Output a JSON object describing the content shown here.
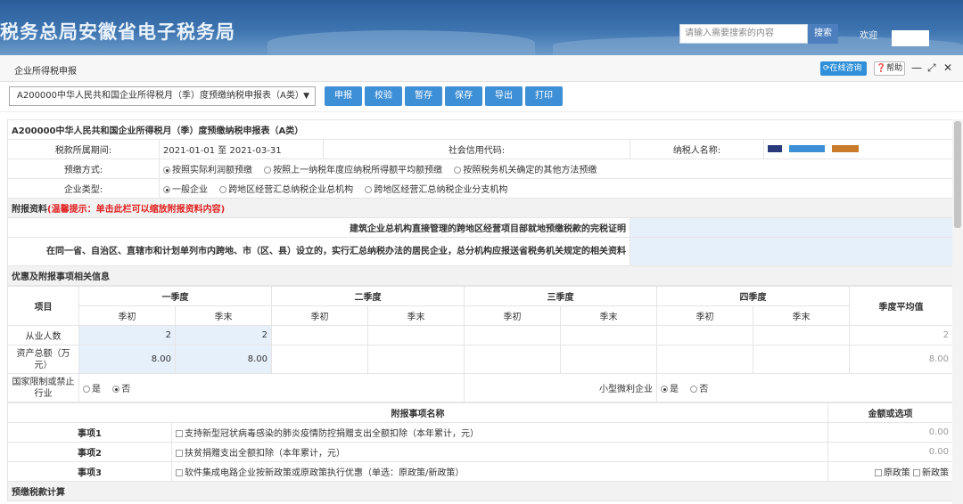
{
  "banner": {
    "title": "税务总局安徽省电子税务局",
    "search_placeholder": "请输入需要搜索的内容",
    "search_button": "搜索",
    "welcome": "欢迎"
  },
  "window": {
    "title": "企业所得税申报",
    "consult": "在线咨询",
    "help": "帮助",
    "minimize": "—",
    "maximize": "⤢",
    "close": "✕"
  },
  "toolbar": {
    "form_select": "A200000中华人民共和国企业所得税月（季）度预缴纳税申报表（A类）",
    "buttons": [
      "申报",
      "校验",
      "暂存",
      "保存",
      "导出",
      "打印"
    ]
  },
  "form": {
    "header": "A200000中华人民共和国企业所得税月（季）度预缴纳税申报表（A类）",
    "period_label": "税款所属期间:",
    "period_value": "2021-01-01 至 2021-03-31",
    "credit_code_label": "社会信用代码:",
    "taxpayer_label": "纳税人名称:",
    "prepay_label": "预缴方式:",
    "prepay_options": [
      "按照实际利润额预缴",
      "按照上一纳税年度应纳税所得额平均额预缴",
      "按照税务机关确定的其他方法预缴"
    ],
    "company_type_label": "企业类型:",
    "company_type_options": [
      "一般企业",
      "跨地区经营汇总纳税企业总机构",
      "跨地区经营汇总纳税企业分支机构"
    ],
    "attach_title": "附报资料",
    "attach_tip": "(温馨提示：单击此栏可以缩放附报资料内容)",
    "attach_item1": "建筑企业总机构直接管理的跨地区经营项目部就地预缴税款的完税证明",
    "attach_item2": "在同一省、自治区、直辖市和计划单列市内跨地、市（区、县）设立的，实行汇总纳税办法的居民企业，总分机构应报送省税务机关规定的相关资料",
    "benefit_title": "优惠及附报事项相关信息",
    "col_item": "项目",
    "quarters": [
      "一季度",
      "二季度",
      "三季度",
      "四季度"
    ],
    "q_start": "季初",
    "q_end": "季末",
    "avg": "季度平均值",
    "employees_label": "从业人数",
    "employees_q1_start": "2",
    "employees_q1_end": "2",
    "employees_avg": "2",
    "assets_label": "资产总额（万元）",
    "assets_q1_start": "8.00",
    "assets_q1_end": "8.00",
    "assets_avg": "8.00",
    "restricted_label": "国家限制或禁止行业",
    "yes": "是",
    "no": "否",
    "small_label": "小型微利企业",
    "matters_title": "附报事项名称",
    "amount_title": "金额或选项",
    "matters": [
      {
        "name": "事项1",
        "desc": "支持新型冠状病毒感染的肺炎疫情防控捐赠支出全额扣除（本年累计，元）",
        "value": "0.00"
      },
      {
        "name": "事项2",
        "desc": "扶贫捐赠支出全额扣除（本年累计，元）",
        "value": "0.00"
      },
      {
        "name": "事项3",
        "desc": "软件集成电路企业按新政策或原政策执行优惠（单选：原政策/新政策）",
        "opt1": "原政策",
        "opt2": "新政策"
      }
    ],
    "next_section": "预缴税款计算"
  }
}
